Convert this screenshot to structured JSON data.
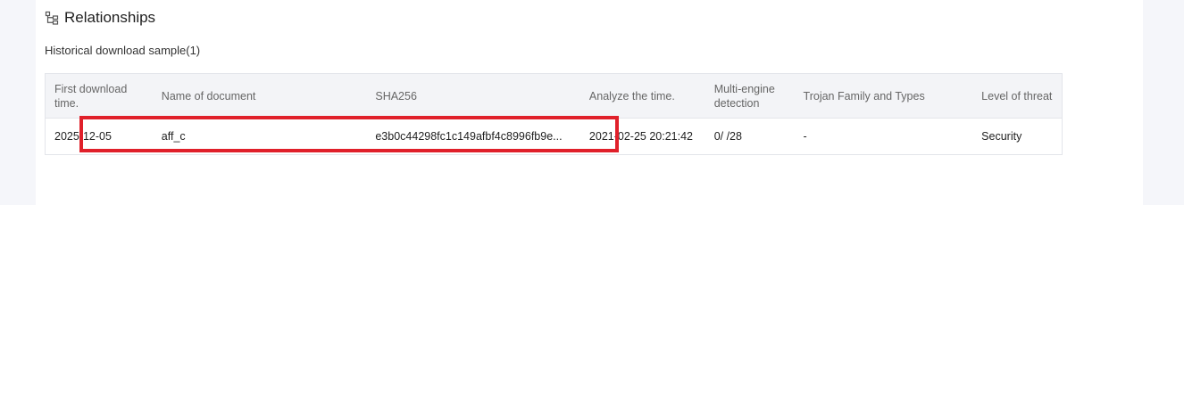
{
  "section": {
    "title": "Relationships",
    "icon": "hierarchy-icon",
    "subtitle": "Historical download sample(1)"
  },
  "table": {
    "headers": [
      "First download time.",
      "Name of document",
      "SHA256",
      "Analyze the time.",
      "Multi-engine detection",
      "Trojan Family and Types",
      "Level of threat"
    ],
    "rows": [
      {
        "first_download": "2025-12-05",
        "name": "aff_c",
        "sha256": "e3b0c44298fc1c149afbf4c8996fb9e...",
        "analyze_time": "2021-02-25 20:21:42",
        "detection": "0/ /28",
        "family": "-",
        "threat": "Security"
      }
    ]
  },
  "colors": {
    "threat_security": "#1fa86a",
    "highlight": "#e0202a"
  }
}
